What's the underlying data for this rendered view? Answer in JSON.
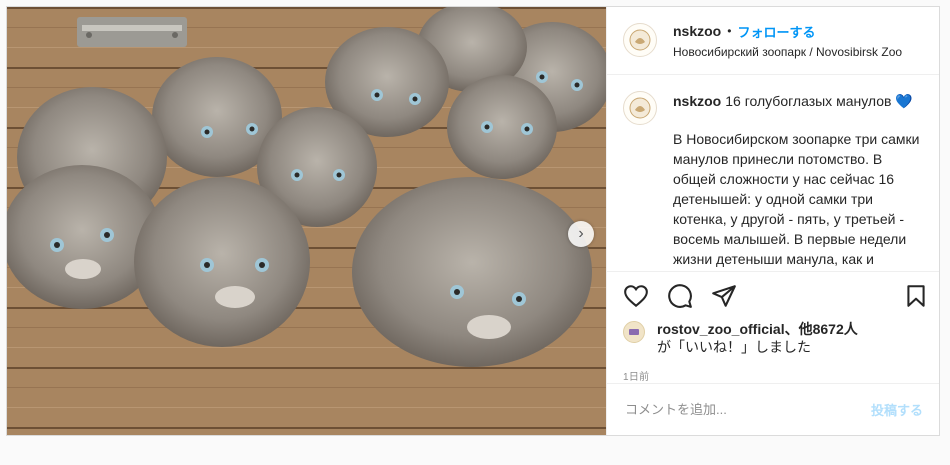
{
  "post": {
    "username": "nskzoo",
    "separator": "•",
    "follow_label": "フォローする",
    "location": "Новосибирский зоопарк / Novosibirsk Zoo",
    "caption_title": "16 голубоглазых манулов 💙",
    "caption_body": "В Новосибирском зоопарке три самки манулов принесли потомство. В общей сложности у нас сейчас 16 детенышей: у одной самки три котенка, у другой - пять, у третьей - восемь малышей. В первые недели жизни детеныши манула, как и малыши всех кошачьих, абсолютно",
    "likes_user": "rostov_zoo_official",
    "likes_rest": "、他8672人",
    "likes_suffix": "が「いいね！」しました",
    "time_ago": "1日前",
    "comment_placeholder": "コメントを追加...",
    "post_button": "投稿する",
    "next_arrow": "›"
  },
  "icons": {
    "like": "heart-icon",
    "comment": "comment-icon",
    "share": "paper-plane-icon",
    "save": "bookmark-icon"
  },
  "colors": {
    "accent": "#0095f6",
    "post_button_disabled": "#b2dffc",
    "secondary_text": "#8e8e8e"
  }
}
